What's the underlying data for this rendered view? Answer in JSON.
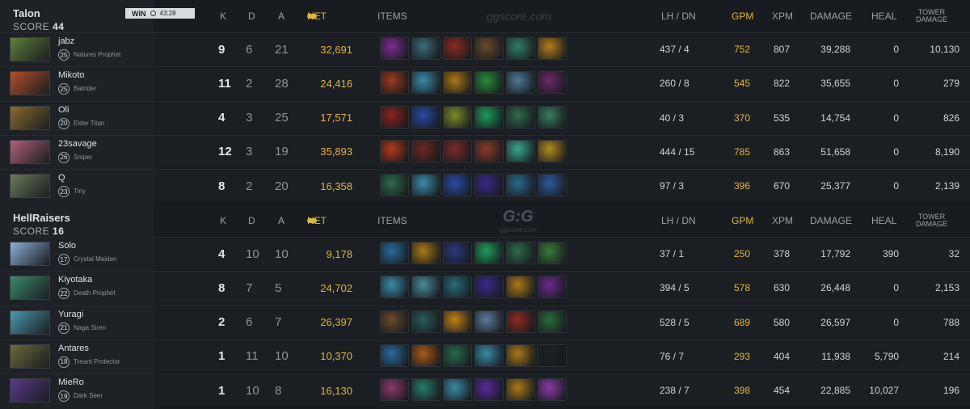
{
  "teams": [
    {
      "name": "Talon",
      "score_label": "SCORE",
      "score": "44",
      "result": "WIN",
      "duration": "43:28",
      "players": [
        {
          "name": "jabz",
          "level": "25",
          "hero": "Natures Prophet",
          "k": "9",
          "d": "6",
          "a": "21",
          "net": "32,691",
          "lhdn": "437 / 4",
          "gpm": "752",
          "xpm": "807",
          "damage": "39,288",
          "heal": "0",
          "tower": "10,130",
          "portrait": "#5e7f3a",
          "items": [
            "#7a2d8e",
            "#3d6a78",
            "#8a2a24",
            "#6a4a2c",
            "#2f7c66",
            "#b07d1c"
          ]
        },
        {
          "name": "Mikoto",
          "level": "25",
          "hero": "Batrider",
          "k": "11",
          "d": "2",
          "a": "28",
          "net": "24,416",
          "lhdn": "260 / 8",
          "gpm": "545",
          "xpm": "822",
          "damage": "35,655",
          "heal": "0",
          "tower": "279",
          "portrait": "#b1502a",
          "items": [
            "#9a3a20",
            "#3a8aa6",
            "#a87818",
            "#2c8a3c",
            "#4e7694",
            "#6a2a6a"
          ]
        },
        {
          "name": "Oli",
          "level": "20",
          "hero": "Elder Titan",
          "k": "4",
          "d": "3",
          "a": "25",
          "net": "17,571",
          "lhdn": "40 / 3",
          "gpm": "370",
          "xpm": "535",
          "damage": "14,754",
          "heal": "0",
          "tower": "826",
          "portrait": "#8a6a2c",
          "items": [
            "#8a2222",
            "#2a4aa6",
            "#7a8a2a",
            "#1e9a5a",
            "#2e6a4a",
            "#3a7a5e"
          ]
        },
        {
          "name": "23savage",
          "level": "26",
          "hero": "Sniper",
          "k": "12",
          "d": "3",
          "a": "19",
          "net": "35,893",
          "lhdn": "444 / 15",
          "gpm": "785",
          "xpm": "863",
          "damage": "51,658",
          "heal": "0",
          "tower": "8,190",
          "portrait": "#b0607a",
          "items": [
            "#b03a1a",
            "#6a2a22",
            "#7a2a2a",
            "#8a3a2a",
            "#3aa68a",
            "#b08a1c"
          ]
        },
        {
          "name": "Q",
          "level": "23",
          "hero": "Tiny",
          "k": "8",
          "d": "2",
          "a": "20",
          "net": "16,358",
          "lhdn": "97 / 3",
          "gpm": "396",
          "xpm": "670",
          "damage": "25,377",
          "heal": "0",
          "tower": "2,139",
          "portrait": "#6a7a5a",
          "items": [
            "#2e6a4a",
            "#3a8aa6",
            "#2a4aa6",
            "#3a2a8a",
            "#2a6a8a",
            "#2a5a9a"
          ]
        }
      ]
    },
    {
      "name": "HellRaisers",
      "score_label": "SCORE",
      "score": "16",
      "players": [
        {
          "name": "Solo",
          "level": "17",
          "hero": "Crystal Maiden",
          "k": "4",
          "d": "10",
          "a": "10",
          "net": "9,178",
          "lhdn": "37 / 1",
          "gpm": "250",
          "xpm": "378",
          "damage": "17,792",
          "heal": "390",
          "tower": "32",
          "portrait": "#8ab0d6",
          "items": [
            "#2a6a9a",
            "#a87818",
            "#2a3a7a",
            "#1e9a5a",
            "#2e6a4a",
            "#3a7a3a"
          ]
        },
        {
          "name": "Kiyotaka",
          "level": "22",
          "hero": "Death Prophet",
          "k": "8",
          "d": "7",
          "a": "5",
          "net": "24,702",
          "lhdn": "394 / 5",
          "gpm": "578",
          "xpm": "630",
          "damage": "26,448",
          "heal": "0",
          "tower": "2,153",
          "portrait": "#3a8a6a",
          "items": [
            "#3a8aa6",
            "#4a8a9a",
            "#2a6a7a",
            "#3a2a8a",
            "#a87818",
            "#6a2a8a"
          ]
        },
        {
          "name": "Yuragi",
          "level": "21",
          "hero": "Naga Siren",
          "k": "2",
          "d": "6",
          "a": "7",
          "net": "26,397",
          "lhdn": "528 / 5",
          "gpm": "689",
          "xpm": "580",
          "damage": "26,597",
          "heal": "0",
          "tower": "788",
          "portrait": "#4a9ab0",
          "items": [
            "#6a4a2c",
            "#2a5a5a",
            "#c0801a",
            "#5a7a9a",
            "#8a2a22",
            "#2a6a3a"
          ]
        },
        {
          "name": "Antares",
          "level": "18",
          "hero": "Treant Protector",
          "k": "1",
          "d": "11",
          "a": "10",
          "net": "10,370",
          "lhdn": "76 / 7",
          "gpm": "293",
          "xpm": "404",
          "damage": "11,938",
          "heal": "5,790",
          "tower": "214",
          "portrait": "#6a6a3a",
          "items": [
            "#2a6a9a",
            "#a85a18",
            "#2a6a4a",
            "#3a8aa6",
            "#a87818",
            "#1e2226"
          ]
        },
        {
          "name": "MieRo",
          "level": "19",
          "hero": "Dark Seer",
          "k": "1",
          "d": "10",
          "a": "8",
          "net": "16,130",
          "lhdn": "238 / 7",
          "gpm": "398",
          "xpm": "454",
          "damage": "22,885",
          "heal": "10,027",
          "tower": "196",
          "portrait": "#5a3a8a",
          "items": [
            "#8a3a6a",
            "#2a7a6a",
            "#3a8aa6",
            "#5a2a9a",
            "#a87818",
            "#8a3aa6"
          ]
        }
      ]
    }
  ],
  "columns": {
    "k": "K",
    "d": "D",
    "a": "A",
    "net": "NET",
    "items": "ITEMS",
    "lhdn": "LH / DN",
    "gpm": "GPM",
    "xpm": "XPM",
    "damage": "DAMAGE",
    "heal": "HEAL",
    "tower_line1": "TOWER",
    "tower_line2": "DAMAGE"
  },
  "watermark": "ggscore.com",
  "logo": {
    "mark": "G:G",
    "sub": "ggscore.com"
  },
  "icons": {
    "coin": "coin-icon",
    "clock": "clock-icon"
  },
  "colors": {
    "gold": "#e0b43a",
    "panel": "#1e2226",
    "row": "#1b1f23"
  }
}
